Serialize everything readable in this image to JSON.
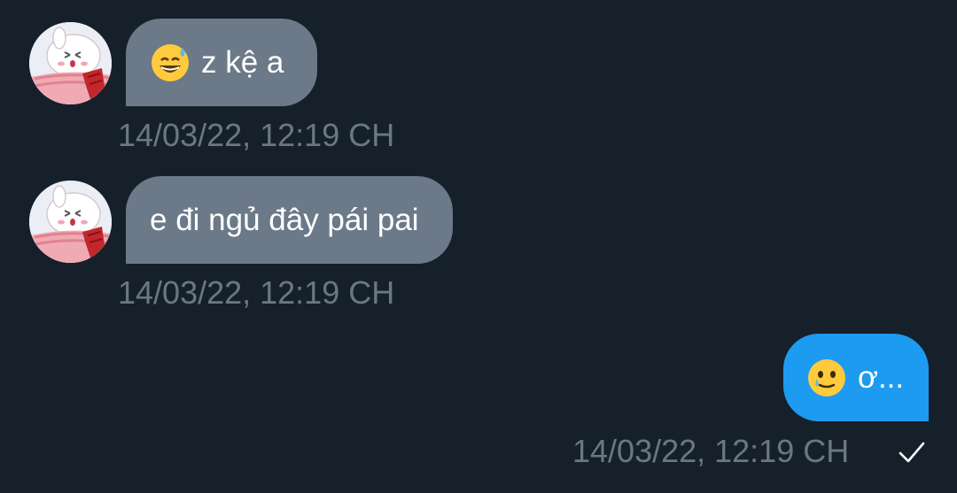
{
  "colors": {
    "background": "#16202a",
    "incoming_bubble": "#6b7988",
    "outgoing_bubble": "#1d9bf0",
    "timestamp": "#6b7785",
    "text": "#ffffff"
  },
  "messages": [
    {
      "direction": "incoming",
      "emoji": "grinning-face-with-sweat-icon",
      "text": "z kệ a",
      "timestamp": "14/03/22, 12:19 CH"
    },
    {
      "direction": "incoming",
      "text": "e đi ngủ đây pái pai",
      "timestamp": "14/03/22, 12:19 CH"
    },
    {
      "direction": "outgoing",
      "emoji": "face-holding-back-tears-icon",
      "text": "ơ...",
      "timestamp": "14/03/22, 12:19 CH",
      "status": "sent-check-icon"
    }
  ]
}
